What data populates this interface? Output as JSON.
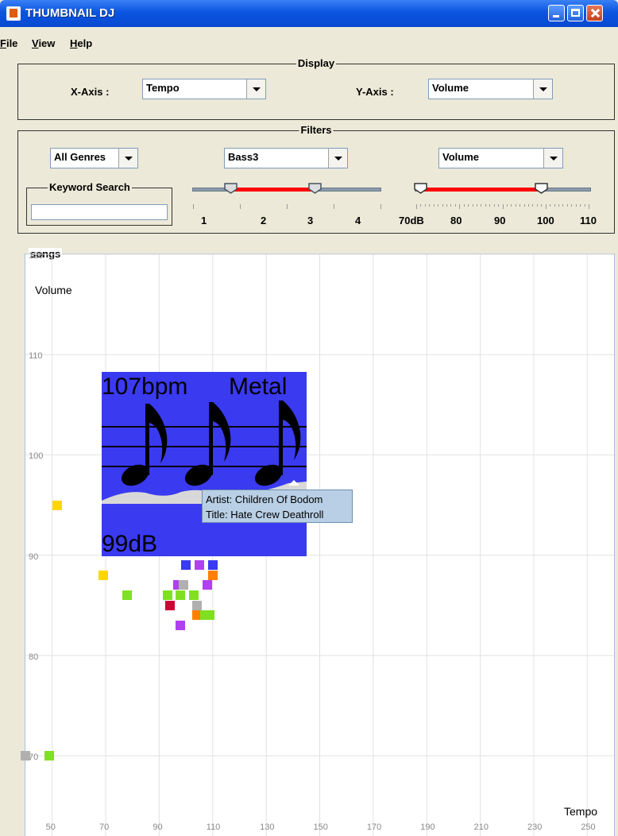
{
  "window": {
    "title": "THUMBNAIL DJ"
  },
  "menubar": {
    "items": [
      "File",
      "View",
      "Help"
    ]
  },
  "display": {
    "title": "Display",
    "x_label": "X-Axis :",
    "x_value": "Tempo",
    "y_label": "Y-Axis :",
    "y_value": "Volume"
  },
  "filters": {
    "title": "Filters",
    "genre_value": "All Genres",
    "bass_value": "Bass3",
    "volume_value": "Volume",
    "keyword_title": "Keyword Search",
    "keyword_value": "",
    "bass_slider": {
      "ticks": [
        "1",
        "2",
        "3",
        "4"
      ],
      "range": [
        1.8,
        3.6
      ]
    },
    "volume_slider": {
      "ticks": [
        "70dB",
        "80",
        "90",
        "100",
        "110"
      ],
      "range": [
        71,
        99
      ]
    }
  },
  "songs": {
    "title": "songs",
    "x_axis_name": "Tempo",
    "y_axis_name": "Volume",
    "y_ticks": [
      "120",
      "110",
      "100",
      "90",
      "80",
      "70"
    ],
    "x_ticks": [
      "50",
      "70",
      "90",
      "110",
      "130",
      "150",
      "170",
      "190",
      "210",
      "230",
      "250"
    ]
  },
  "chart_data": {
    "type": "scatter",
    "xlabel": "Tempo",
    "ylabel": "Volume",
    "xlim": [
      40,
      260
    ],
    "ylim": [
      62,
      120
    ],
    "grid": true,
    "points": [
      {
        "x": 52,
        "y": 95,
        "color": "#ffd700"
      },
      {
        "x": 69,
        "y": 88,
        "color": "#ffd700"
      },
      {
        "x": 78,
        "y": 86,
        "color": "#80e020"
      },
      {
        "x": 93,
        "y": 86,
        "color": "#80e020"
      },
      {
        "x": 94,
        "y": 85,
        "color": "#cc0033"
      },
      {
        "x": 97,
        "y": 87,
        "color": "#b040f0"
      },
      {
        "x": 99,
        "y": 87,
        "color": "#b0b0b0"
      },
      {
        "x": 98,
        "y": 86,
        "color": "#80e020"
      },
      {
        "x": 98,
        "y": 83,
        "color": "#b040f0"
      },
      {
        "x": 103,
        "y": 86,
        "color": "#80e020"
      },
      {
        "x": 104,
        "y": 85,
        "color": "#b0b0b0"
      },
      {
        "x": 104,
        "y": 84,
        "color": "#ff8000"
      },
      {
        "x": 105,
        "y": 89,
        "color": "#b040f0"
      },
      {
        "x": 107,
        "y": 84,
        "color": "#80e020"
      },
      {
        "x": 108,
        "y": 87,
        "color": "#b040f0"
      },
      {
        "x": 109,
        "y": 84,
        "color": "#80e020"
      },
      {
        "x": 110,
        "y": 88,
        "color": "#ff8000"
      },
      {
        "x": 110,
        "y": 89,
        "color": "#3a3af0"
      },
      {
        "x": 100,
        "y": 89,
        "color": "#3a3af0"
      },
      {
        "x": 49,
        "y": 70,
        "color": "#80e020"
      },
      {
        "x": 40,
        "y": 70,
        "color": "#b0b0b0"
      }
    ]
  },
  "thumbnail": {
    "bpm_label": "107bpm",
    "genre_label": "Metal",
    "db_label": "99dB",
    "tooltip_artist": "Artist: Children Of Bodom",
    "tooltip_title": "Title: Hate Crew Deathroll"
  }
}
